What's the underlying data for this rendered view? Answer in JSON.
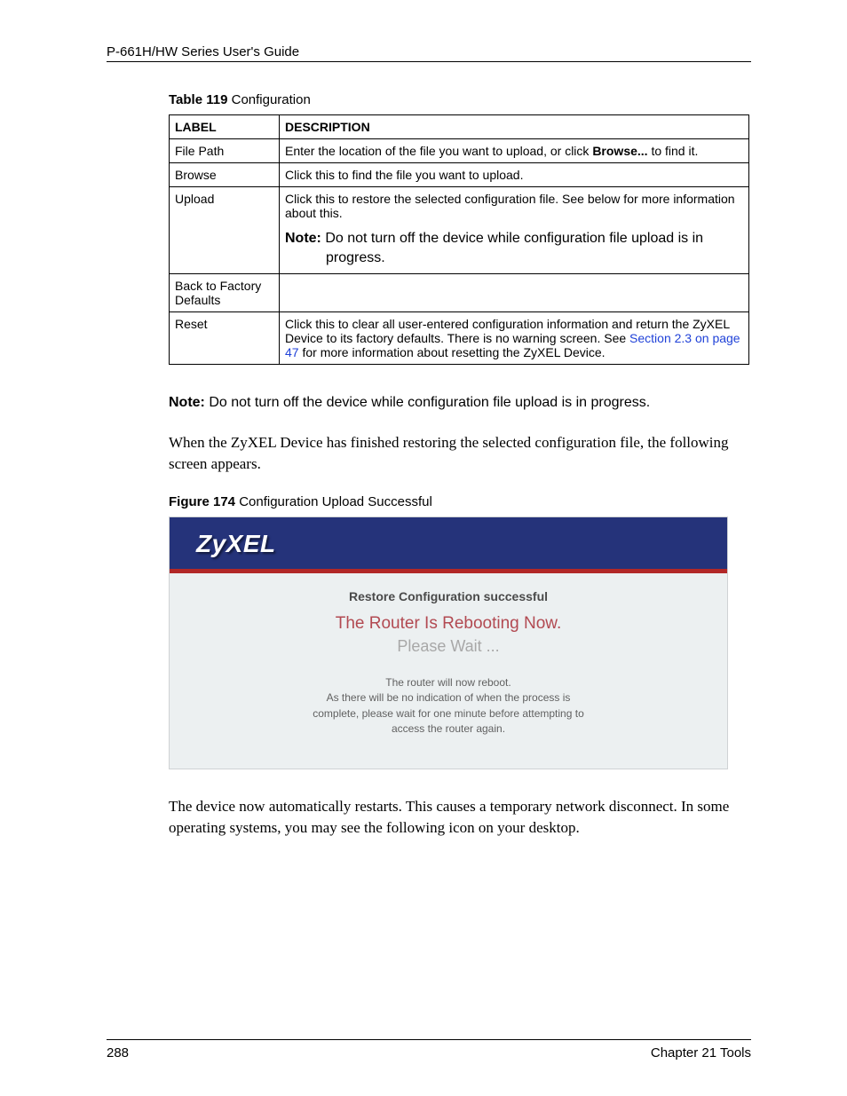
{
  "header": {
    "running_head": "P-661H/HW Series User's Guide"
  },
  "table": {
    "caption_label": "Table 119",
    "caption_text": "   Configuration",
    "th_label": "LABEL",
    "th_desc": "DESCRIPTION",
    "rows": {
      "r1": {
        "label": "File Path",
        "desc_a": "Enter the location of the file you want to upload, or click ",
        "desc_b": "Browse...",
        "desc_c": " to find it."
      },
      "r2": {
        "label": "Browse",
        "desc": "Click this to find the file you want to upload."
      },
      "r3": {
        "label": "Upload",
        "desc1": "Click this to restore the selected configuration file. See below for more information about this.",
        "note_label": "Note:",
        "note_a": " Do not turn off the device while configuration file upload is in",
        "note_b": "progress."
      },
      "r4": {
        "label": "Back to Factory Defaults",
        "desc": ""
      },
      "r5": {
        "label": "Reset",
        "desc_a": "Click this to clear all user-entered configuration information and return the ZyXEL Device to its factory defaults. There is no warning screen. See ",
        "link": "Section 2.3 on page 47",
        "desc_b": " for more information about resetting the ZyXEL Device."
      }
    }
  },
  "note_para": {
    "label": "Note:",
    "text": " Do not turn off the device while configuration file upload is in progress."
  },
  "serif1": "When the ZyXEL Device has finished restoring the selected configuration file, the following screen appears.",
  "figure": {
    "caption_label": "Figure 174",
    "caption_text": "   Configuration Upload Successful",
    "logo": "ZyXEL",
    "title": "Restore Configuration successful",
    "line1": "The Router Is Rebooting Now.",
    "line2": "Please Wait ...",
    "msg1": "The router will now reboot.",
    "msg2": "As there will be no indication of when the process is",
    "msg3": "complete, please wait for one minute before attempting to",
    "msg4": "access the router again."
  },
  "serif2": "The device now automatically restarts. This causes a temporary network disconnect. In some operating systems, you may see the following icon on your desktop.",
  "footer": {
    "page": "288",
    "chapter": "Chapter 21 Tools"
  }
}
